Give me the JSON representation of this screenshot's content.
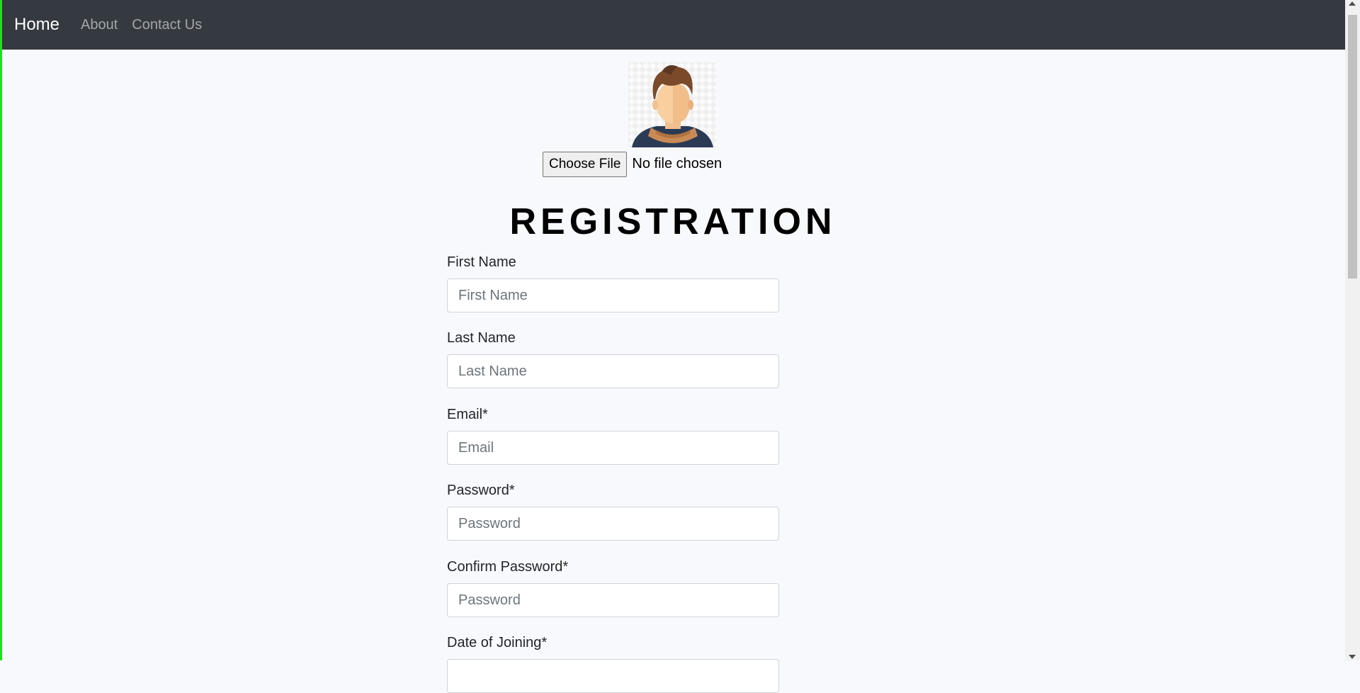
{
  "nav": {
    "brand": "Home",
    "links": [
      "About",
      "Contact Us"
    ]
  },
  "upload": {
    "button_label": "Choose File",
    "status": "No file chosen"
  },
  "title": "REGISTRATION",
  "fields": [
    {
      "label": "First Name",
      "placeholder": "First Name"
    },
    {
      "label": "Last Name",
      "placeholder": "Last Name"
    },
    {
      "label": "Email*",
      "placeholder": "Email"
    },
    {
      "label": "Password*",
      "placeholder": "Password"
    },
    {
      "label": "Confirm Password*",
      "placeholder": "Password"
    },
    {
      "label": "Date of Joining*",
      "placeholder": ""
    }
  ],
  "colors": {
    "navbar": "#343a40",
    "page_background": "#f8f9fc",
    "accent_edge": "#22dd22"
  },
  "icons": {
    "avatar": "avatar-illustration"
  }
}
